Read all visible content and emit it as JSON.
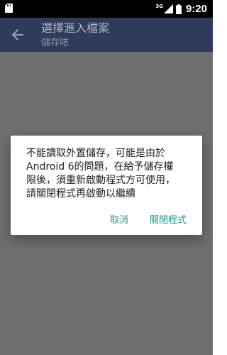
{
  "status_bar": {
    "network": "3G",
    "time": "9:20",
    "icons": [
      "sd-card-icon",
      "signal-icon",
      "battery-icon"
    ]
  },
  "app_bar": {
    "title": "選擇滙入檔案",
    "subtitle": "儲存咭",
    "back_icon": "arrow-back-icon"
  },
  "dialog": {
    "message": "不能讀取外置儲存，可能是由於\nAndroid 6的問題，在給予儲存權\n限後，須重新啟動程式方可使用，\n請關閉程式再啟動以繼續",
    "cancel_label": "取消",
    "close_app_label": "關閉程式"
  },
  "colors": {
    "scrim": "#6f6f6f",
    "app_bar": "#2f3b5c",
    "accent": "#1b9c8a",
    "status_bar": "#000000"
  }
}
